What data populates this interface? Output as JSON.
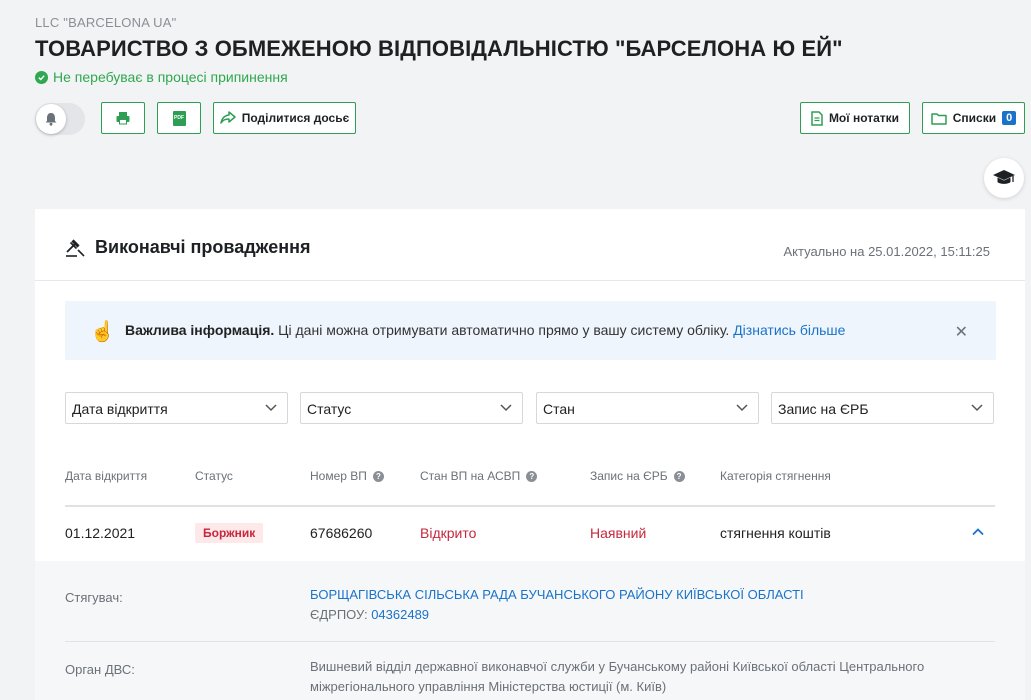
{
  "header": {
    "subtitle": "LLC \"BARCELONA UA\"",
    "title": "ТОВАРИСТВО З ОБМЕЖЕНОЮ ВІДПОВІДАЛЬНІСТЮ \"БАРСЕЛОНА Ю ЕЙ\"",
    "status": "Не перебуває в процесі припинення"
  },
  "toolbar": {
    "share_label": "Поділитися досьє",
    "notes_label": "Мої нотатки",
    "lists_label": "Списки",
    "lists_count": "0",
    "pdf_label": "PDF"
  },
  "card": {
    "title": "Виконавчі провадження",
    "actual": "Актуально на 25.01.2022, 15:11:25"
  },
  "info": {
    "bold": "Важлива інформація.",
    "text": " Ці дані можна отримувати автоматично прямо у вашу систему обліку. ",
    "link": "Дізнатись більше"
  },
  "filters": [
    {
      "label": "Дата відкриття"
    },
    {
      "label": "Статус"
    },
    {
      "label": "Стан"
    },
    {
      "label": "Запис на ЄРБ"
    }
  ],
  "table": {
    "headers": [
      "Дата відкриття",
      "Статус",
      "Номер ВП",
      "Стан ВП на АСВП",
      "Запис на ЄРБ",
      "Категорія стягнення"
    ],
    "row": {
      "date": "01.12.2021",
      "status": "Боржник",
      "number": "67686260",
      "state": "Відкрито",
      "erb": "Наявний",
      "category": "стягнення коштів"
    }
  },
  "detail": {
    "collector_label": "Стягувач:",
    "collector_name": "БОРЩАГІВСЬКА СІЛЬСЬКА РАДА БУЧАНСЬКОГО РАЙОНУ КИЇВСЬКОЇ ОБЛАСТІ",
    "edrpou_label": "ЄДРПОУ: ",
    "edrpou_value": "04362489",
    "dvs_label": "Орган ДВС:",
    "dvs_line1": "Вишневий відділ державної виконавчої служби у Бучанському районі Київської області Центрального",
    "dvs_line2": "міжрегіонального управління Міністерства юстиції (м. Київ)"
  },
  "colors": {
    "accent": "#2e9e54",
    "link": "#1a73c9",
    "danger": "#c5283d"
  },
  "icons": [
    "check-circle-icon",
    "bell-icon",
    "print-icon",
    "pdf-icon",
    "share-icon",
    "note-icon",
    "folder-icon",
    "graduation-cap-icon",
    "gavel-icon",
    "pointing-hand-icon",
    "close-icon",
    "chevron-down-icon",
    "help-icon",
    "chevron-up-icon"
  ]
}
